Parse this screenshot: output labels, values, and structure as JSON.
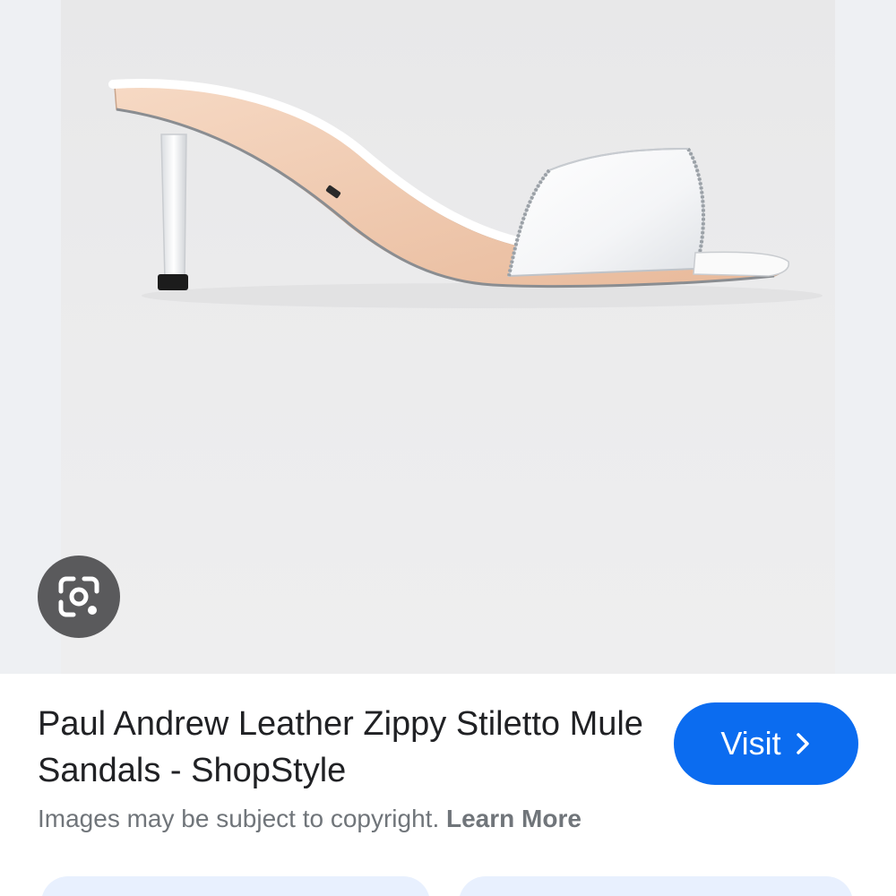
{
  "image": {
    "subject": "white leather mule sandal with stiletto heel",
    "background_color": "#ececed"
  },
  "lens_button": {
    "icon": "google-lens-icon",
    "color": "#5a5a5c"
  },
  "result": {
    "title": "Paul Andrew Leather Zippy Stiletto Mule Sandals - ShopStyle",
    "visit_label": "Visit",
    "visit_icon": "chevron-right-icon",
    "visit_color": "#0b6cf0",
    "copyright_text": "Images may be subject to copyright.",
    "learn_more_label": "Learn More"
  },
  "bottom_actions": {
    "color": "#e8f0fe"
  }
}
